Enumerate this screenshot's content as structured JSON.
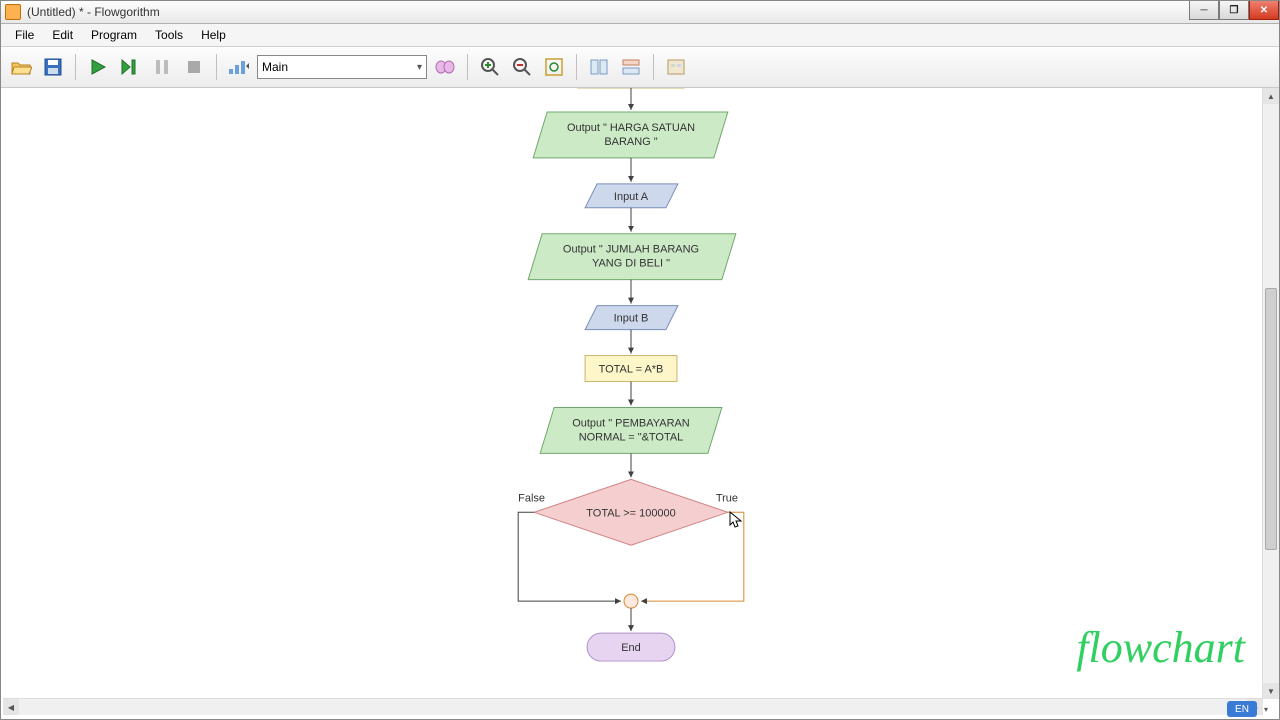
{
  "window": {
    "title": "(Untitled) * - Flowgorithm"
  },
  "menu": {
    "file": "File",
    "edit": "Edit",
    "program": "Program",
    "tools": "Tools",
    "help": "Help"
  },
  "toolbar": {
    "function_selected": "Main"
  },
  "flowchart": {
    "out1": {
      "line1": "Output \" HARGA SATUAN",
      "line2": "BARANG \""
    },
    "in1": "Input A",
    "out2": {
      "line1": "Output \" JUMLAH BARANG",
      "line2": "YANG DI BELI \""
    },
    "in2": "Input B",
    "assign": "TOTAL = A*B",
    "out3": {
      "line1": "Output \" PEMBAYARAN",
      "line2": "NORMAL = \"&TOTAL"
    },
    "cond": "TOTAL >= 100000",
    "false_label": "False",
    "true_label": "True",
    "end": "End"
  },
  "status": {
    "lang": "EN"
  },
  "watermark": "flowchart",
  "colors": {
    "output_fill": "#cdeac7",
    "output_stroke": "#6fa86f",
    "input_fill": "#cdd8ed",
    "input_stroke": "#7a8eb8",
    "assign_fill": "#fdf6c9",
    "assign_stroke": "#c9b56a",
    "cond_fill": "#f5cfcf",
    "cond_stroke": "#d08080",
    "end_fill": "#e6d4f0",
    "end_stroke": "#b090c8",
    "arrow": "#404040",
    "true_line": "#d68a30"
  }
}
